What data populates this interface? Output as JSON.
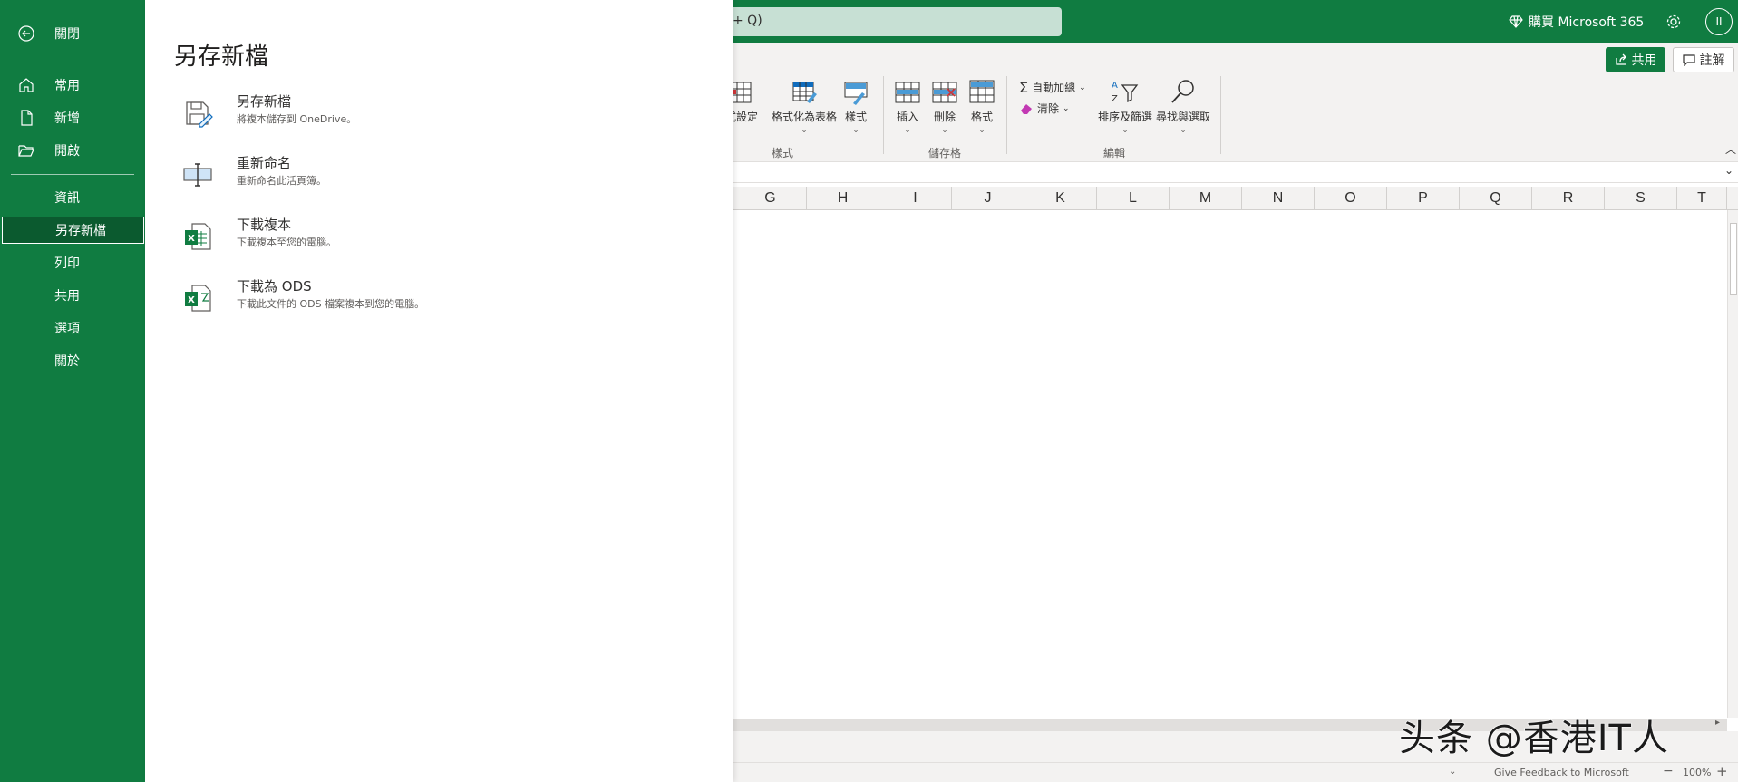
{
  "colors": {
    "brand_green": "#107c41",
    "nav_active": "#0b5a2f",
    "search_bg": "#c7e0d4",
    "ribbon_bg": "#f3f2f1"
  },
  "topbar": {
    "search_text": "+ Q)",
    "buy_label": "購買 Microsoft 365",
    "avatar_initials": "II"
  },
  "toolbar": {
    "share_label": "共用",
    "comments_label": "註解"
  },
  "ribbon": {
    "styles_group": {
      "label": "樣式",
      "items": [
        "式設定",
        "格式化為表格",
        "樣式"
      ]
    },
    "cells_group": {
      "label": "儲存格",
      "items": [
        "插入",
        "刪除",
        "格式"
      ]
    },
    "editing_group": {
      "label": "編輯",
      "autosum": "自動加總",
      "clear": "清除",
      "sort_filter": "排序及篩選",
      "find_select": "尋找與選取"
    }
  },
  "columns": [
    "G",
    "H",
    "I",
    "J",
    "K",
    "L",
    "M",
    "N",
    "O",
    "P",
    "Q",
    "R",
    "S",
    "T"
  ],
  "statusbar": {
    "feedback": "Give Feedback to Microsoft",
    "zoom": "100%",
    "zoom_minus": "−",
    "zoom_plus": "+"
  },
  "watermark": "头条 @香港IT人",
  "backstage": {
    "nav": {
      "close": "關閉",
      "home": "常用",
      "new": "新增",
      "open": "開啟",
      "info": "資訊",
      "save_as": "另存新檔",
      "print": "列印",
      "share": "共用",
      "options": "選項",
      "about": "關於"
    },
    "panel_title": "另存新檔",
    "options": [
      {
        "title": "另存新檔",
        "desc": "將複本儲存到 OneDrive。",
        "icon": "save-as-icon"
      },
      {
        "title": "重新命名",
        "desc": "重新命名此活頁簿。",
        "icon": "rename-icon"
      },
      {
        "title": "下載複本",
        "desc": "下載複本至您的電腦。",
        "icon": "excel-file-icon"
      },
      {
        "title": "下載為 ODS",
        "desc": "下載此文件的 ODS 檔案複本到您的電腦。",
        "icon": "ods-file-icon"
      }
    ]
  }
}
